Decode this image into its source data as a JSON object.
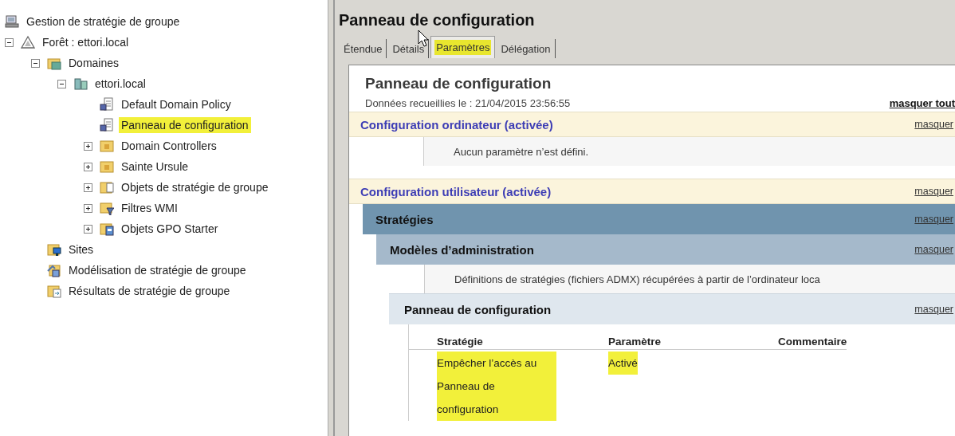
{
  "tree": {
    "label": "Gestion de stratégie de groupe",
    "kind": "console",
    "selected": false,
    "children": [
      {
        "label": "Forêt : ettori.local",
        "kind": "forest",
        "expanded": true,
        "selected": false,
        "children": [
          {
            "label": "Domaines",
            "kind": "domains",
            "expanded": true,
            "selected": false,
            "children": [
              {
                "label": "ettori.local",
                "kind": "domain",
                "expanded": true,
                "selected": false,
                "children": [
                  {
                    "label": "Default Domain Policy",
                    "kind": "gpo",
                    "selected": false
                  },
                  {
                    "label": "Panneau de configuration",
                    "kind": "gpo",
                    "selected": true
                  },
                  {
                    "label": "Domain Controllers",
                    "kind": "ou",
                    "expanded": false,
                    "selected": false
                  },
                  {
                    "label": "Sainte Ursule",
                    "kind": "ou",
                    "expanded": false,
                    "selected": false
                  },
                  {
                    "label": "Objets de stratégie de groupe",
                    "kind": "gpofolder",
                    "expanded": false,
                    "selected": false
                  },
                  {
                    "label": "Filtres WMI",
                    "kind": "wmi",
                    "expanded": false,
                    "selected": false
                  },
                  {
                    "label": "Objets GPO Starter",
                    "kind": "starter",
                    "expanded": false,
                    "selected": false
                  }
                ]
              }
            ]
          },
          {
            "label": "Sites",
            "kind": "sites",
            "selected": false
          },
          {
            "label": "Modélisation de stratégie de groupe",
            "kind": "modeling",
            "selected": false
          },
          {
            "label": "Résultats de stratégie de groupe",
            "kind": "results",
            "selected": false
          }
        ]
      }
    ]
  },
  "details": {
    "title": "Panneau de configuration",
    "tabs": [
      {
        "label": "Étendue",
        "selected": false
      },
      {
        "label": "Détails",
        "selected": false
      },
      {
        "label": "Paramètres",
        "selected": true
      },
      {
        "label": "Délégation",
        "selected": false
      }
    ],
    "report": {
      "title": "Panneau de configuration",
      "collected": "Données recueillies le : 21/04/2015 23:56:55",
      "hide_all": "masquer tout",
      "sections": [
        {
          "kind": "section",
          "title": "Configuration ordinateur (activée)",
          "link": "masquer",
          "children": [
            {
              "kind": "note",
              "text": "Aucun paramètre n’est défini."
            }
          ]
        },
        {
          "kind": "section",
          "title": "Configuration utilisateur (activée)",
          "link": "masquer",
          "children": [
            {
              "kind": "group",
              "title": "Stratégies",
              "link": "masquer",
              "children": [
                {
                  "kind": "group",
                  "title": "Modèles d’administration",
                  "link": "masquer",
                  "children": [
                    {
                      "kind": "note",
                      "text": "Définitions de stratégies (fichiers ADMX) récupérées à partir de l’ordinateur loca"
                    },
                    {
                      "kind": "group",
                      "title": "Panneau de configuration",
                      "link": "masquer",
                      "children": [
                        {
                          "kind": "table",
                          "columns": [
                            "Stratégie",
                            "Paramètre",
                            "Commentaire"
                          ],
                          "rows": [
                            {
                              "cells": [
                                "Empêcher l’accès au Panneau de configuration",
                                "Activé"
                              ],
                              "highlighted": true
                            }
                          ]
                        }
                      ]
                    }
                  ]
                }
              ]
            }
          ]
        }
      ]
    }
  }
}
